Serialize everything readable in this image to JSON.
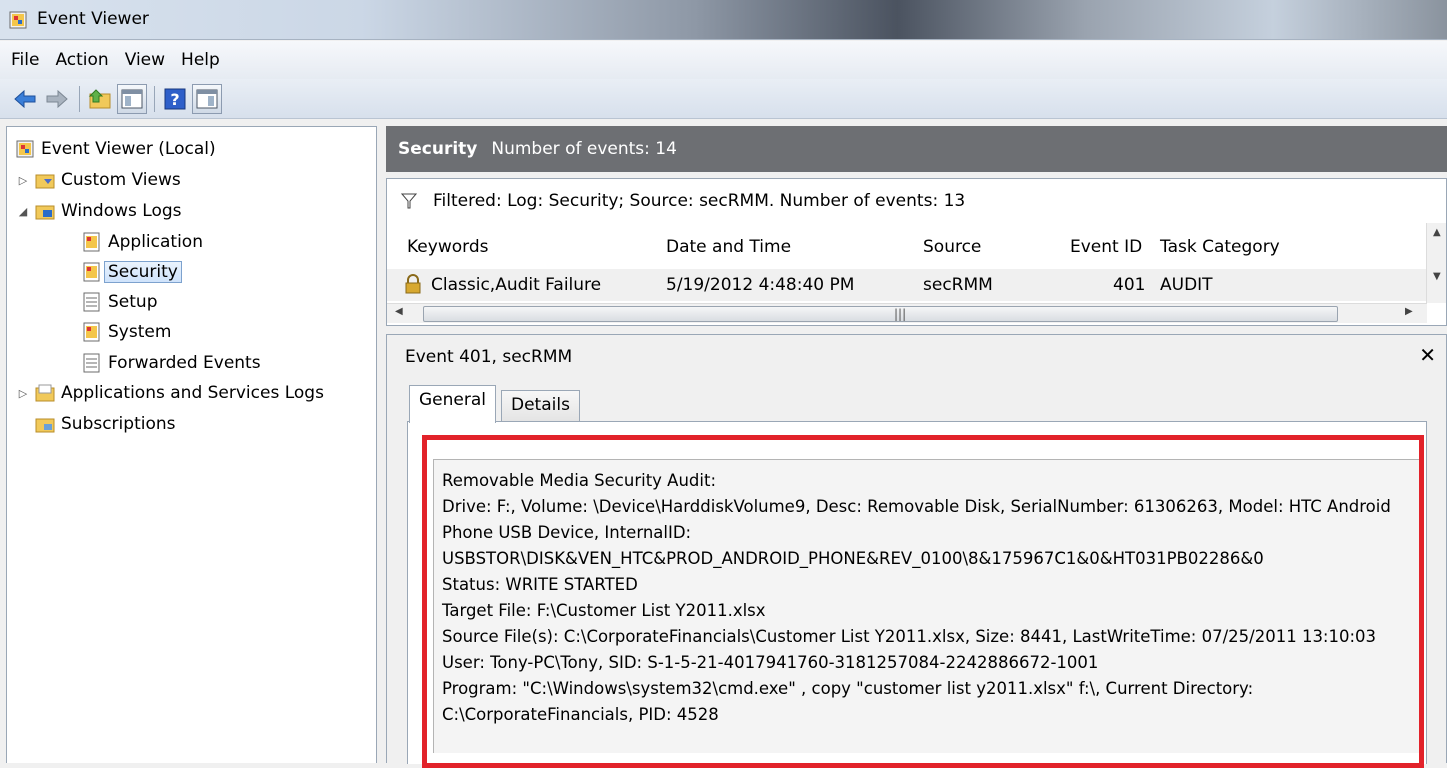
{
  "window": {
    "title": "Event Viewer"
  },
  "menu": [
    "File",
    "Action",
    "View",
    "Help"
  ],
  "toolbar": {
    "buttons": [
      "back-icon",
      "forward-icon",
      "up-folder-icon",
      "show-hide-tree-icon",
      "help-icon",
      "show-hide-action-pane-icon"
    ]
  },
  "tree": {
    "root": "Event Viewer (Local)",
    "custom_views": "Custom Views",
    "windows_logs": "Windows Logs",
    "logs": [
      "Application",
      "Security",
      "Setup",
      "System",
      "Forwarded Events"
    ],
    "apps_services": "Applications and Services Logs",
    "subscriptions": "Subscriptions"
  },
  "log_header": {
    "name": "Security",
    "count": "Number of events: 14"
  },
  "filter": "Filtered: Log: Security; Source: secRMM. Number of events: 13",
  "events": {
    "columns": [
      "Keywords",
      "Date and Time",
      "Source",
      "Event ID",
      "Task Category"
    ],
    "rows": [
      {
        "keywords": "Classic,Audit Failure",
        "date": "5/19/2012 4:48:40 PM",
        "source": "secRMM",
        "event_id": "401",
        "task": "AUDIT"
      }
    ]
  },
  "detail": {
    "title": "Event 401, secRMM",
    "tabs": [
      "General",
      "Details"
    ],
    "description": "Removable Media Security Audit:\nDrive: F:, Volume: \\Device\\HarddiskVolume9, Desc: Removable Disk, SerialNumber: 61306263, Model: HTC Android Phone USB Device, InternalID: USBSTOR\\DISK&VEN_HTC&PROD_ANDROID_PHONE&REV_0100\\8&175967C1&0&HT031PB02286&0\nStatus: WRITE STARTED\nTarget File: F:\\Customer List Y2011.xlsx\nSource File(s): C:\\CorporateFinancials\\Customer List Y2011.xlsx, Size: 8441, LastWriteTime: 07/25/2011 13:10:03\nUser: Tony-PC\\Tony, SID: S-1-5-21-4017941760-3181257084-2242886672-1001\nProgram: \"C:\\Windows\\system32\\cmd.exe\" , copy \"customer list y2011.xlsx\" f:\\, Current Directory: C:\\CorporateFinancials, PID: 4528"
  },
  "colors": {
    "highlight": "#e2222a",
    "header_bg": "#6d6f73"
  }
}
